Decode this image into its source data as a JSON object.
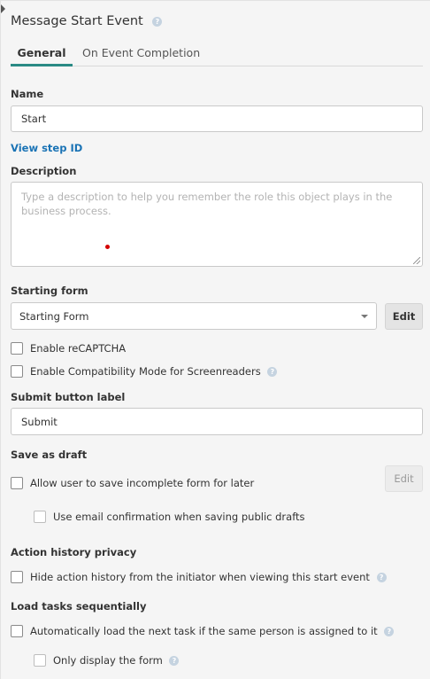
{
  "panel": {
    "title": "Message Start Event"
  },
  "tabs": [
    {
      "label": "General",
      "active": true
    },
    {
      "label": "On Event Completion",
      "active": false
    }
  ],
  "name": {
    "label": "Name",
    "value": "Start"
  },
  "view_step_id": "View step ID",
  "description": {
    "label": "Description",
    "placeholder": "Type a description to help you remember the role this object plays in the business process."
  },
  "starting_form": {
    "label": "Starting form",
    "selected": "Starting Form",
    "edit_label": "Edit"
  },
  "checkboxes": {
    "recaptcha": "Enable reCAPTCHA",
    "compat_mode": "Enable Compatibility Mode for Screenreaders"
  },
  "submit_label": {
    "label": "Submit button label",
    "value": "Submit"
  },
  "save_as_draft": {
    "label": "Save as draft",
    "allow_save": "Allow user to save incomplete form for later",
    "edit_label": "Edit",
    "email_confirm": "Use email confirmation when saving public drafts"
  },
  "action_history": {
    "label": "Action history privacy",
    "hide": "Hide action history from the initiator when viewing this start event"
  },
  "load_tasks": {
    "label": "Load tasks sequentially",
    "auto_load": "Automatically load the next task if the same person is assigned to it",
    "only_form": "Only display the form"
  },
  "colors": {
    "accent": "#2a8a85",
    "link": "#1a73b5",
    "background": "#f5f5f5"
  },
  "icons": {
    "help": "question-circle-icon",
    "dropdown": "caret-down-icon"
  }
}
